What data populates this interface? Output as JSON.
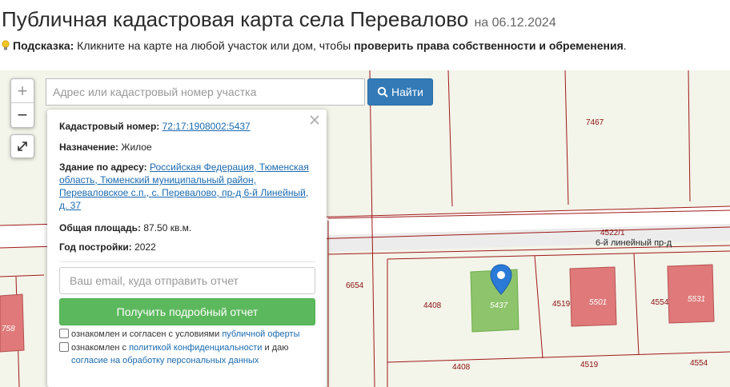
{
  "header": {
    "title": "Публичная кадастровая карта села Перевалово",
    "date": "на 06.12.2024"
  },
  "hint": {
    "label": "Подсказка:",
    "text": " Кликните на карте на любой участок или дом, чтобы ",
    "bold": "проверить права собственности и обременения",
    "end": "."
  },
  "search": {
    "placeholder": "Адрес или кадастровый номер участка",
    "button": "Найти"
  },
  "zoom": {
    "plus": "+",
    "minus": "−"
  },
  "popup": {
    "cad_label": "Кадастровый номер:",
    "cad_value": "72:17:1908002:5437",
    "purpose_label": "Назначение:",
    "purpose_value": "Жилое",
    "address_label": "Здание по адресу:",
    "address_value": "Российская Федерация, Тюменская область, Тюменский муниципальный район, Переваловское с.п., с. Перевалово, пр-д 6-й Линейный, д. 37",
    "area_label": "Общая площадь:",
    "area_value": "87.50 кв.м.",
    "year_label": "Год постройки:",
    "year_value": "2022",
    "email_placeholder": "Ваш email, куда отправить отчет",
    "report_button": "Получить подробный отчет",
    "check1_text": "ознакомлен и согласен с условиями ",
    "check1_link": "публичной оферты",
    "check2_text": "ознакомлен с ",
    "check2_link": "политикой конфиденциальности",
    "check2_text2": " и даю",
    "check2_link2": "согласие на обработку персональных данных"
  },
  "map_labels": {
    "p7467": "7467",
    "p4522": "4522/1",
    "street": "6-й линейный пр-д",
    "p6654": "6654",
    "p4408a": "4408",
    "p5437": "5437",
    "p4519a": "4519",
    "p5501": "5501",
    "p4554a": "4554",
    "p5531": "5531",
    "p4408b": "4408",
    "p4519b": "4519",
    "p4554b": "4554",
    "p758": "758"
  },
  "colors": {
    "accent": "#337ab7",
    "success": "#5cb85c",
    "building": "#e07a7a",
    "selected": "#8ec46b",
    "boundary": "#a01818",
    "marker": "#2b7ad8"
  },
  "icons": {
    "hint": "lightbulb-icon",
    "search": "search-icon",
    "close": "close-icon",
    "fullscreen": "expand-icon",
    "marker": "map-marker-icon"
  }
}
